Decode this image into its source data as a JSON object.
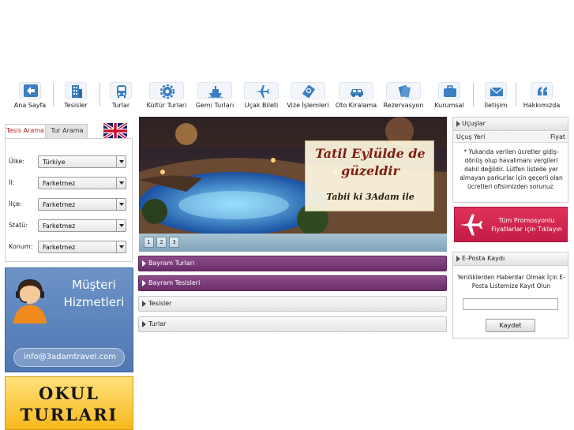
{
  "nav": {
    "items": [
      {
        "label": "Ana Sayfa",
        "icon": "arrow-left-icon"
      },
      {
        "label": "Tesisler",
        "icon": "building-icon"
      },
      {
        "label": "Turlar",
        "icon": "bus-icon"
      },
      {
        "label": "Kültür Turları",
        "icon": "gear-icon"
      },
      {
        "label": "Gemi Turları",
        "icon": "ship-icon"
      },
      {
        "label": "Uçak Bileti",
        "icon": "airplane-icon"
      },
      {
        "label": "Vize İşlemleri",
        "icon": "passport-icon"
      },
      {
        "label": "Oto Kiralama",
        "icon": "car-icon"
      },
      {
        "label": "Rezervasyon",
        "icon": "document-icon"
      },
      {
        "label": "Kurumsal",
        "icon": "briefcase-icon"
      },
      {
        "label": "İletişim",
        "icon": "envelope-icon"
      },
      {
        "label": "Hakkımızda",
        "icon": "quote-icon"
      }
    ]
  },
  "search": {
    "tabs": [
      "Tesis Arama",
      "Tur Arama"
    ],
    "active_tab": "Tesis Arama",
    "fields": [
      {
        "label": "Ülke:",
        "value": "Türkiye"
      },
      {
        "label": "İl:",
        "value": "Farketmez"
      },
      {
        "label": "İlçe:",
        "value": "Farketmez"
      },
      {
        "label": "Statü:",
        "value": "Farketmez"
      },
      {
        "label": "Konum:",
        "value": "Farketmez"
      }
    ]
  },
  "customer_service": {
    "title_line1": "Müşteri",
    "title_line2": "Hizmetleri",
    "email": "info@3adamtravel.com"
  },
  "okul_banner": {
    "line1": "OKUL",
    "line2": "TURLARI"
  },
  "slider": {
    "caption_line1": "Tatil Eylülde de",
    "caption_line2": "güzeldir",
    "caption_line3": "Tabii ki 3Adam ile",
    "pages": [
      "1",
      "2",
      "3"
    ]
  },
  "accordion": [
    {
      "label": "Bayram Turları",
      "style": "purple"
    },
    {
      "label": "Bayram Tesisleri",
      "style": "purple"
    },
    {
      "label": "Tesisler",
      "style": "grey"
    },
    {
      "label": "Turlar",
      "style": "grey"
    }
  ],
  "flights": {
    "title": "Uçuşlar",
    "col_from": "Uçuş Yeri",
    "col_price": "Fiyat",
    "note": "* Yukarıda verilen ücretler gidiş-dönüş olup havalimanı vergileri dahil değildir. Lütfen listede yer almayan parkurlar için geçerli olan ücretleri ofisimizden sorunuz."
  },
  "promo": {
    "line1": "Tüm Promosyonlu",
    "line2": "Fiyatlarlar için Tıklayın"
  },
  "newsletter": {
    "title": "E-Posta Kaydı",
    "text": "Yeniliklerden Haberdar Olmak İçin E-Posta Listemize Kayıt Olun",
    "input_value": "",
    "button": "Kaydet"
  },
  "colors": {
    "accordion_purple": "#7a3c79",
    "promo_red": "#d4284f",
    "banner_blue": "#5f86be",
    "banner_yellow": "#f7c535"
  }
}
